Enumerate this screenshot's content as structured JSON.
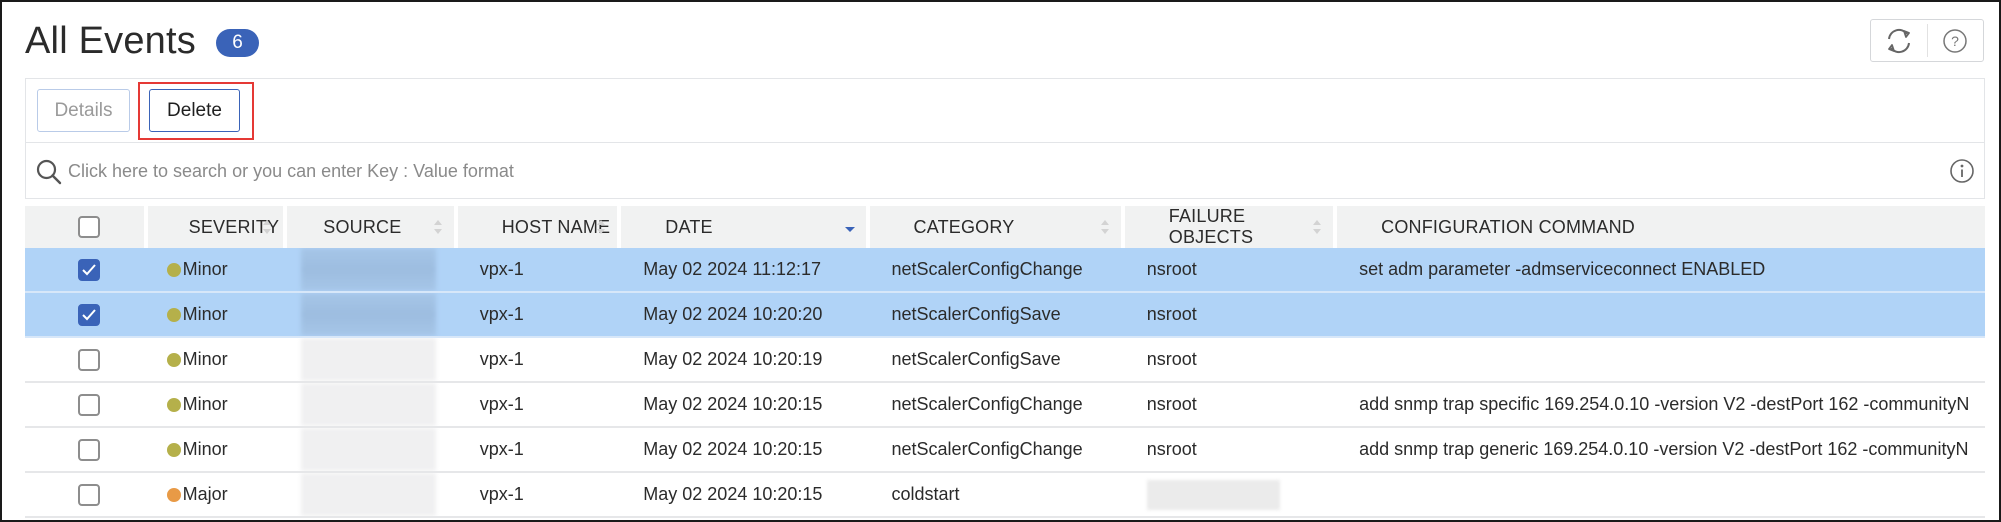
{
  "header": {
    "title": "All Events",
    "count": "6",
    "tools": [
      {
        "name": "refresh",
        "icon": "refresh-icon"
      },
      {
        "name": "help",
        "icon": "help-icon"
      }
    ]
  },
  "toolbar": {
    "details_label": "Details",
    "delete_label": "Delete"
  },
  "search": {
    "placeholder": "Click here to search or you can enter Key : Value format",
    "value": ""
  },
  "colors": {
    "accent": "#3a63b8",
    "selected_row": "#b0d3f7",
    "minor": "#b5b04a",
    "major": "#e89a46",
    "highlight": "#e53935"
  },
  "table": {
    "columns": [
      {
        "key": "select",
        "label": ""
      },
      {
        "key": "severity",
        "label": "SEVERITY",
        "sortable": true
      },
      {
        "key": "source",
        "label": "SOURCE",
        "sortable": true
      },
      {
        "key": "host_name",
        "label": "HOST NAME",
        "sortable": true
      },
      {
        "key": "date",
        "label": "DATE",
        "sortable": true,
        "sorted": "desc"
      },
      {
        "key": "category",
        "label": "CATEGORY",
        "sortable": true
      },
      {
        "key": "failure_objects",
        "label": "FAILURE OBJECTS",
        "sortable": true
      },
      {
        "key": "configuration_command",
        "label": "CONFIGURATION COMMAND",
        "sortable": false
      }
    ],
    "rows": [
      {
        "checked": true,
        "severity": "Minor",
        "severity_color": "#b5b04a",
        "source": "",
        "host_name": "vpx-1",
        "date": "May 02 2024 11:12:17",
        "category": "netScalerConfigChange",
        "failure_objects": "nsroot",
        "configuration_command": "set adm parameter -admserviceconnect ENABLED"
      },
      {
        "checked": true,
        "severity": "Minor",
        "severity_color": "#b5b04a",
        "source": "",
        "host_name": "vpx-1",
        "date": "May 02 2024 10:20:20",
        "category": "netScalerConfigSave",
        "failure_objects": "nsroot",
        "configuration_command": ""
      },
      {
        "checked": false,
        "severity": "Minor",
        "severity_color": "#b5b04a",
        "source": "",
        "host_name": "vpx-1",
        "date": "May 02 2024 10:20:19",
        "category": "netScalerConfigSave",
        "failure_objects": "nsroot",
        "configuration_command": ""
      },
      {
        "checked": false,
        "severity": "Minor",
        "severity_color": "#b5b04a",
        "source": "",
        "host_name": "vpx-1",
        "date": "May 02 2024 10:20:15",
        "category": "netScalerConfigChange",
        "failure_objects": "nsroot",
        "configuration_command": "add snmp trap specific 169.254.0.10 -version V2 -destPort 162 -communityN"
      },
      {
        "checked": false,
        "severity": "Minor",
        "severity_color": "#b5b04a",
        "source": "",
        "host_name": "vpx-1",
        "date": "May 02 2024 10:20:15",
        "category": "netScalerConfigChange",
        "failure_objects": "nsroot",
        "configuration_command": "add snmp trap generic 169.254.0.10 -version V2 -destPort 162 -communityN"
      },
      {
        "checked": false,
        "severity": "Major",
        "severity_color": "#e89a46",
        "source": "",
        "host_name": "vpx-1",
        "date": "May 02 2024 10:20:15",
        "category": "coldstart",
        "failure_objects": "",
        "failure_objects_redacted": true,
        "configuration_command": ""
      }
    ]
  }
}
